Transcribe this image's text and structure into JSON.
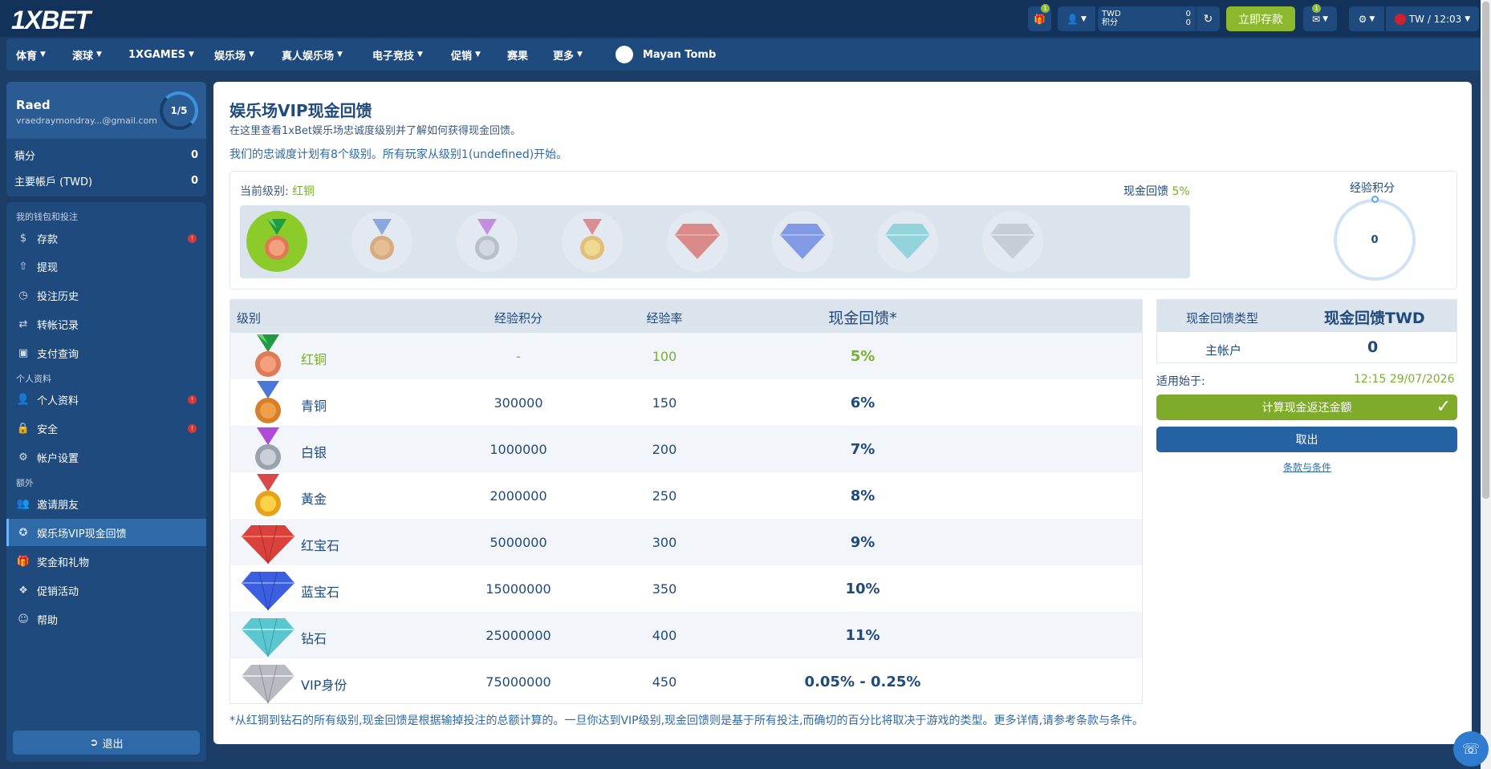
{
  "header": {
    "logo": "1XBET",
    "gift_badge": "1",
    "balance": {
      "currency": "TWD",
      "points_label": "积分",
      "money": "0",
      "points": "0"
    },
    "deposit_label": "立即存款",
    "mail_badge": "1",
    "locale_time": "TW / 12:03"
  },
  "nav": {
    "items": [
      "体育",
      "滚球",
      "1XGAMES",
      "娱乐场",
      "真人娱乐场",
      "电子竞技",
      "促销",
      "赛果",
      "更多"
    ],
    "featured": "Mayan Tomb"
  },
  "user": {
    "name": "Raed",
    "email": "vraedraymondray...@gmail.com",
    "level_progress": "1/5",
    "points_label": "積分",
    "points_value": "0",
    "main_account_label": "主要帳戶 (TWD)",
    "main_account_value": "0"
  },
  "sidebar": {
    "section_wallet": "我的钱包和投注",
    "section_profile": "个人资料",
    "section_extra": "额外",
    "items": [
      {
        "label": "存款",
        "icon": "dollar-icon",
        "warn": true
      },
      {
        "label": "提现",
        "icon": "upload-icon",
        "warn": false
      },
      {
        "label": "投注历史",
        "icon": "clock-icon",
        "warn": false
      },
      {
        "label": "转帐记录",
        "icon": "transfer-icon",
        "warn": false
      },
      {
        "label": "支付查询",
        "icon": "payment-query-icon",
        "warn": false
      },
      {
        "label": "个人资料",
        "icon": "user-icon",
        "warn": true
      },
      {
        "label": "安全",
        "icon": "lock-icon",
        "warn": true
      },
      {
        "label": "帐户设置",
        "icon": "gear-icon",
        "warn": false
      },
      {
        "label": "邀请朋友",
        "icon": "friends-icon",
        "warn": false
      },
      {
        "label": "娱乐场VIP现金回馈",
        "icon": "vip-icon",
        "warn": false,
        "active": true
      },
      {
        "label": "奖金和礼物",
        "icon": "gift-icon",
        "warn": false
      },
      {
        "label": "促销活动",
        "icon": "tag-icon",
        "warn": false
      },
      {
        "label": "帮助",
        "icon": "support-agent-icon",
        "warn": false
      }
    ],
    "logout_label": "退出"
  },
  "main": {
    "title": "娱乐场VIP现金回馈",
    "subtitle": "在这里查看1xBet娱乐场忠诚度级别并了解如何获得现金回馈。",
    "info": "我们的忠诚度计划有8个级别。所有玩家从级别1(undefined)开始。",
    "current_level_label": "当前级别:",
    "current_level_value": "红铜",
    "current_cashback_label": "现金回馈",
    "current_cashback_value": "5%",
    "xp_title": "经验积分",
    "xp_value": "0"
  },
  "table": {
    "headers": {
      "level": "级别",
      "xp": "经验积分",
      "rate": "经验率",
      "cashback": "现金回馈*"
    },
    "rows": [
      {
        "name": "红铜",
        "xp": "-",
        "rate": "100",
        "cashback": "5%",
        "icon": "copper-medal-icon"
      },
      {
        "name": "青铜",
        "xp": "300000",
        "rate": "150",
        "cashback": "6%",
        "icon": "bronze-medal-icon"
      },
      {
        "name": "白银",
        "xp": "1000000",
        "rate": "200",
        "cashback": "7%",
        "icon": "silver-medal-icon"
      },
      {
        "name": "黃金",
        "xp": "2000000",
        "rate": "250",
        "cashback": "8%",
        "icon": "gold-medal-icon"
      },
      {
        "name": "红宝石",
        "xp": "5000000",
        "rate": "300",
        "cashback": "9%",
        "icon": "ruby-gem-icon"
      },
      {
        "name": "蓝宝石",
        "xp": "15000000",
        "rate": "350",
        "cashback": "10%",
        "icon": "sapphire-gem-icon"
      },
      {
        "name": "钻石",
        "xp": "25000000",
        "rate": "400",
        "cashback": "11%",
        "icon": "diamond-gem-icon"
      },
      {
        "name": "VIP身份",
        "xp": "75000000",
        "rate": "450",
        "cashback": "0.05% - 0.25%",
        "icon": "vip-gem-icon"
      }
    ]
  },
  "cashback_panel": {
    "type_label": "现金回馈类型",
    "type_value": "现金回馈TWD",
    "account_label": "主帐户",
    "account_value": "0",
    "valid_from_label": "适用始于:",
    "valid_from_value": "12:15 29/07/2026",
    "calc_label": "计算现金返还金额",
    "cancel_label": "取出",
    "terms_label": "条款与条件"
  },
  "footnote": "*从红铜到钻石的所有级别,现金回馈是根据输掉投注的总额计算的。一旦你达到VIP级别,现金回馈则是基于所有投注,而确切的百分比将取决于游戏的类型。更多详情,请参考条款与条件。",
  "colors": {
    "header_bg": "#133259",
    "nav_bg": "#1e4a7e",
    "accent_green": "#7ab02c",
    "primary_blue": "#2562a3"
  }
}
